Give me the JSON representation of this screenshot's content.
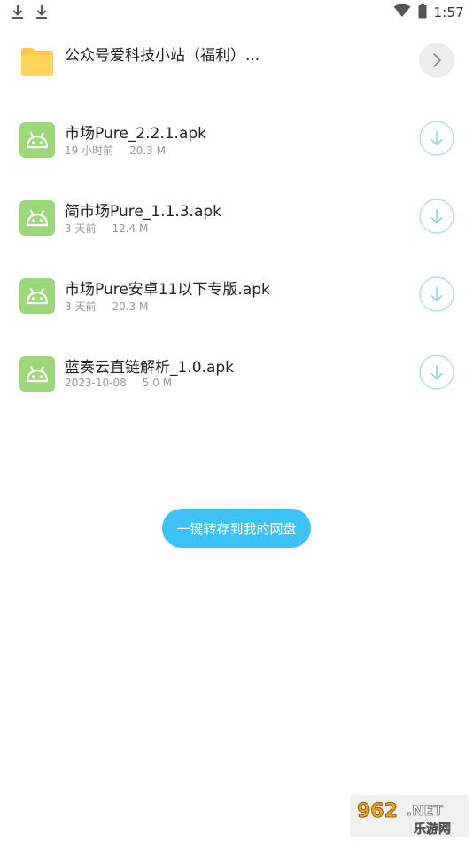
{
  "status_bar": {
    "time": "1:57",
    "icons": [
      "download-icon",
      "download-icon",
      "wifi-icon",
      "battery-icon"
    ]
  },
  "folder": {
    "name": "公众号爱科技小站（福利）...",
    "icon": "folder-icon",
    "action_icon": "chevron-right-icon"
  },
  "files": [
    {
      "name": "市场Pure_2.2.1.apk",
      "time": "19 小时前",
      "size": "20.3 M",
      "icon": "android-icon",
      "action_icon": "download-circle-icon"
    },
    {
      "name": "简市场Pure_1.1.3.apk",
      "time": "3 天前",
      "size": "12.4 M",
      "icon": "android-icon",
      "action_icon": "download-circle-icon"
    },
    {
      "name": "市场Pure安卓11以下专版.apk",
      "time": "3 天前",
      "size": "20.3 M",
      "icon": "android-icon",
      "action_icon": "download-circle-icon"
    },
    {
      "name": "蓝奏云直链解析_1.0.apk",
      "time": "2023-10-08",
      "size": "5.0 M",
      "icon": "android-icon",
      "action_icon": "download-circle-icon"
    }
  ],
  "save_button": {
    "label": "一键转存到我的网盘"
  },
  "watermark": {
    "brand": "962.NET",
    "subtitle": "乐游网"
  },
  "colors": {
    "accent": "#3cc2f4",
    "folder": "#ffc94a",
    "android": "#9bd97a",
    "meta_text": "#9a9a9a"
  }
}
